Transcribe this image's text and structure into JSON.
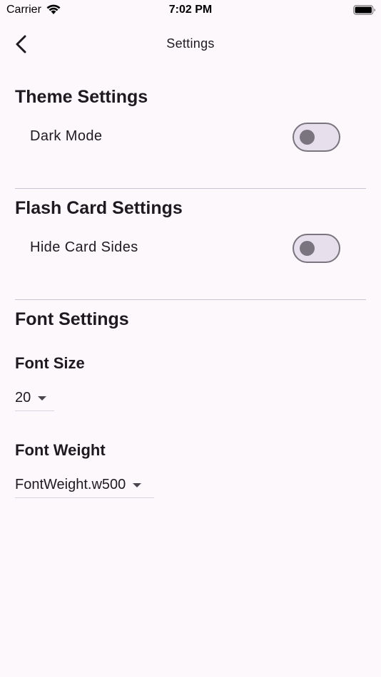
{
  "status_bar": {
    "carrier": "Carrier",
    "time": "7:02 PM"
  },
  "app_bar": {
    "title": "Settings",
    "back_icon": "chevron-left-icon"
  },
  "theme": {
    "title": "Theme Settings",
    "dark_mode_label": "Dark Mode",
    "dark_mode_on": false
  },
  "flash_card": {
    "title": "Flash Card Settings",
    "hide_sides_label": "Hide Card Sides",
    "hide_sides_on": false
  },
  "font": {
    "title": "Font Settings",
    "size_label": "Font Size",
    "size_value": "20",
    "weight_label": "Font Weight",
    "weight_value": "FontWeight.w500"
  },
  "colors": {
    "background": "#fdf8fc",
    "switch_track": "#e7e0ec",
    "switch_outline": "#79747e",
    "divider": "#cac4d0"
  }
}
